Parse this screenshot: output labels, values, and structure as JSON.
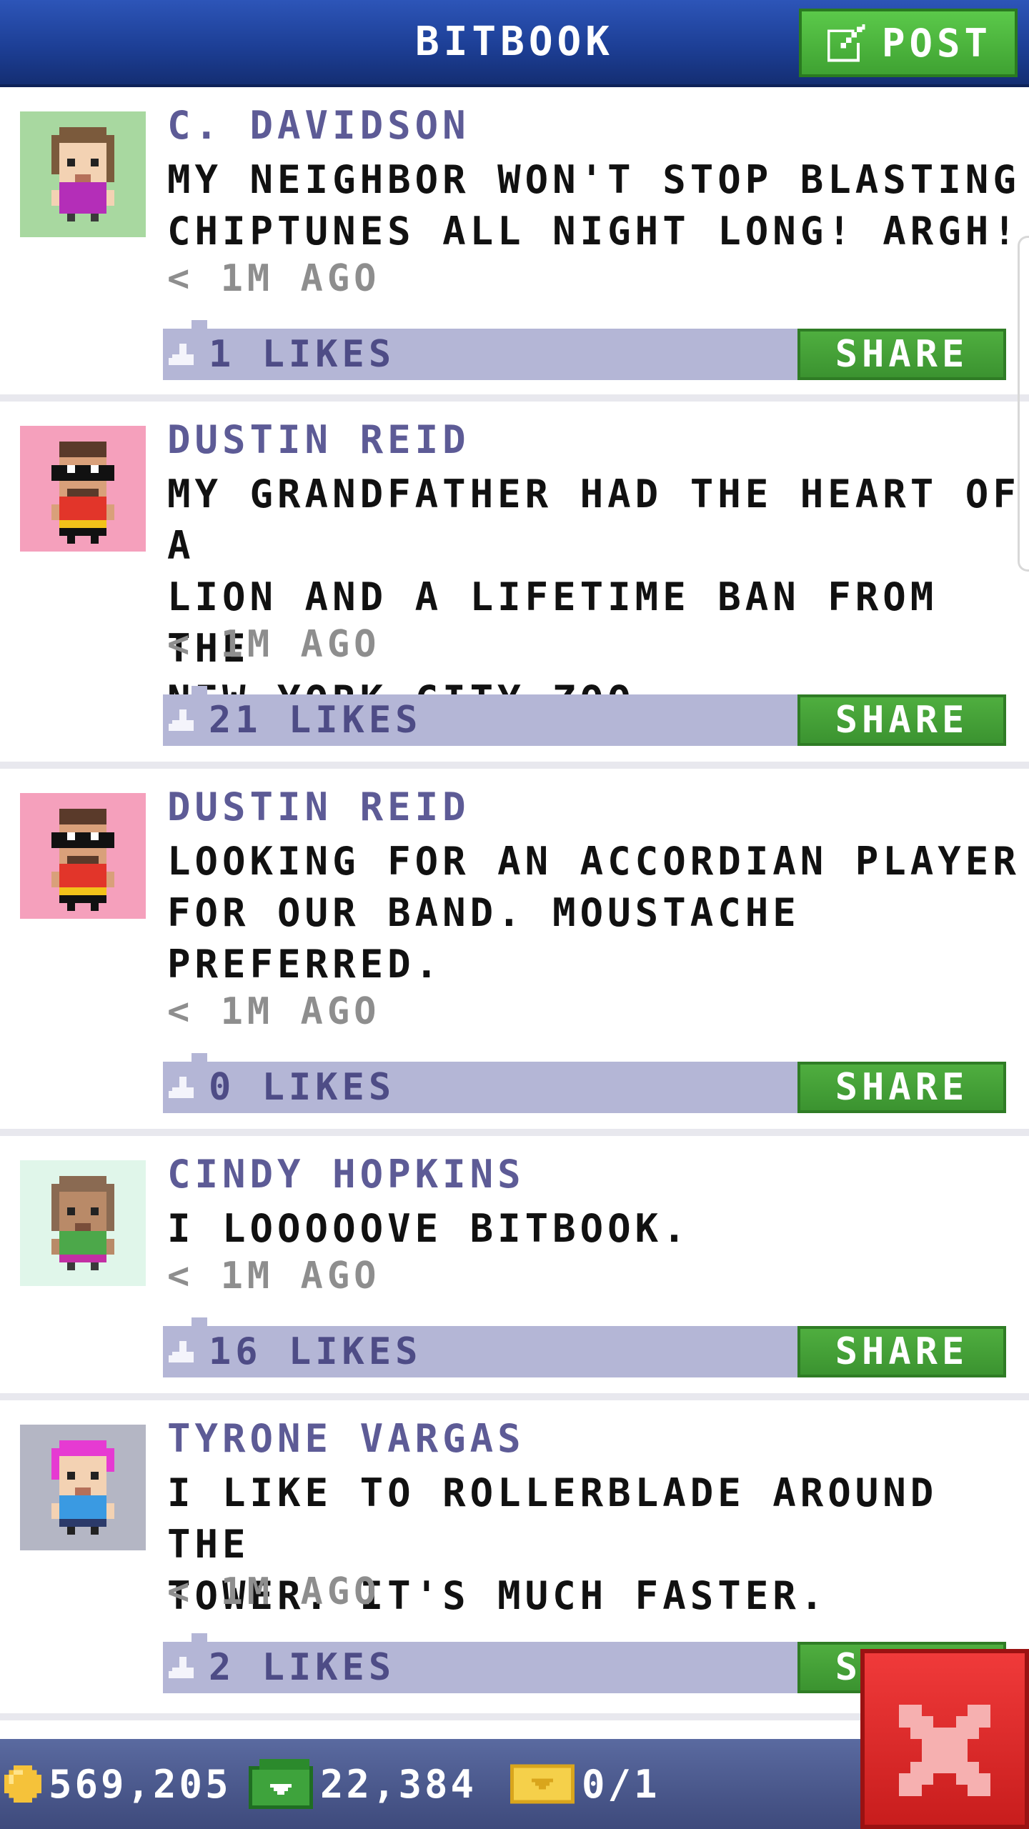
{
  "header": {
    "title": "BITBOOK",
    "post_button_label": "POST"
  },
  "posts": [
    {
      "author": "C. DAVIDSON",
      "message": "MY NEIGHBOR WON'T STOP BLASTING\nCHIPTUNES ALL NIGHT LONG! ARGH!",
      "time": "< 1M AGO",
      "likes": "1 LIKES",
      "share_label": "SHARE",
      "avatar_bg": "#a8d8a0"
    },
    {
      "author": "DUSTIN REID",
      "message": "MY GRANDFATHER HAD THE HEART OF A\nLION AND A LIFETIME BAN FROM THE\nNEW YORK CITY ZOO.",
      "time": "< 1M AGO",
      "likes": "21 LIKES",
      "share_label": "SHARE",
      "avatar_bg": "#f5a0bc"
    },
    {
      "author": "DUSTIN REID",
      "message": "LOOKING FOR AN ACCORDIAN PLAYER\nFOR OUR BAND. MOUSTACHE\nPREFERRED.",
      "time": "< 1M AGO",
      "likes": "0 LIKES",
      "share_label": "SHARE",
      "avatar_bg": "#f5a0bc"
    },
    {
      "author": "CINDY HOPKINS",
      "message": "I LOOOOOVE BITBOOK.",
      "time": "< 1M AGO",
      "likes": "16 LIKES",
      "share_label": "SHARE",
      "avatar_bg": "#e0f6ea"
    },
    {
      "author": "TYRONE VARGAS",
      "message": "I LIKE TO ROLLERBLADE AROUND THE\nTOWER. IT'S MUCH FASTER.",
      "time": "< 1M AGO",
      "likes": "2 LIKES",
      "share_label": "SHARE",
      "avatar_bg": "#b4b6c4"
    }
  ],
  "footer": {
    "coins": "569,205",
    "bux": "22,384",
    "tickets": "0/1"
  },
  "icons": {
    "post": "edit-icon",
    "like": "thumbs-up-icon",
    "coin": "coin-icon",
    "bux": "bux-icon",
    "ticket": "ticket-icon",
    "close": "close-icon"
  },
  "colors": {
    "header": "#1d3f96",
    "green_button": "#3fa232",
    "author_text": "#5d5b96",
    "like_bar": "#b4b6d6",
    "close_button": "#e02828",
    "footer": "#3e4a7c"
  }
}
